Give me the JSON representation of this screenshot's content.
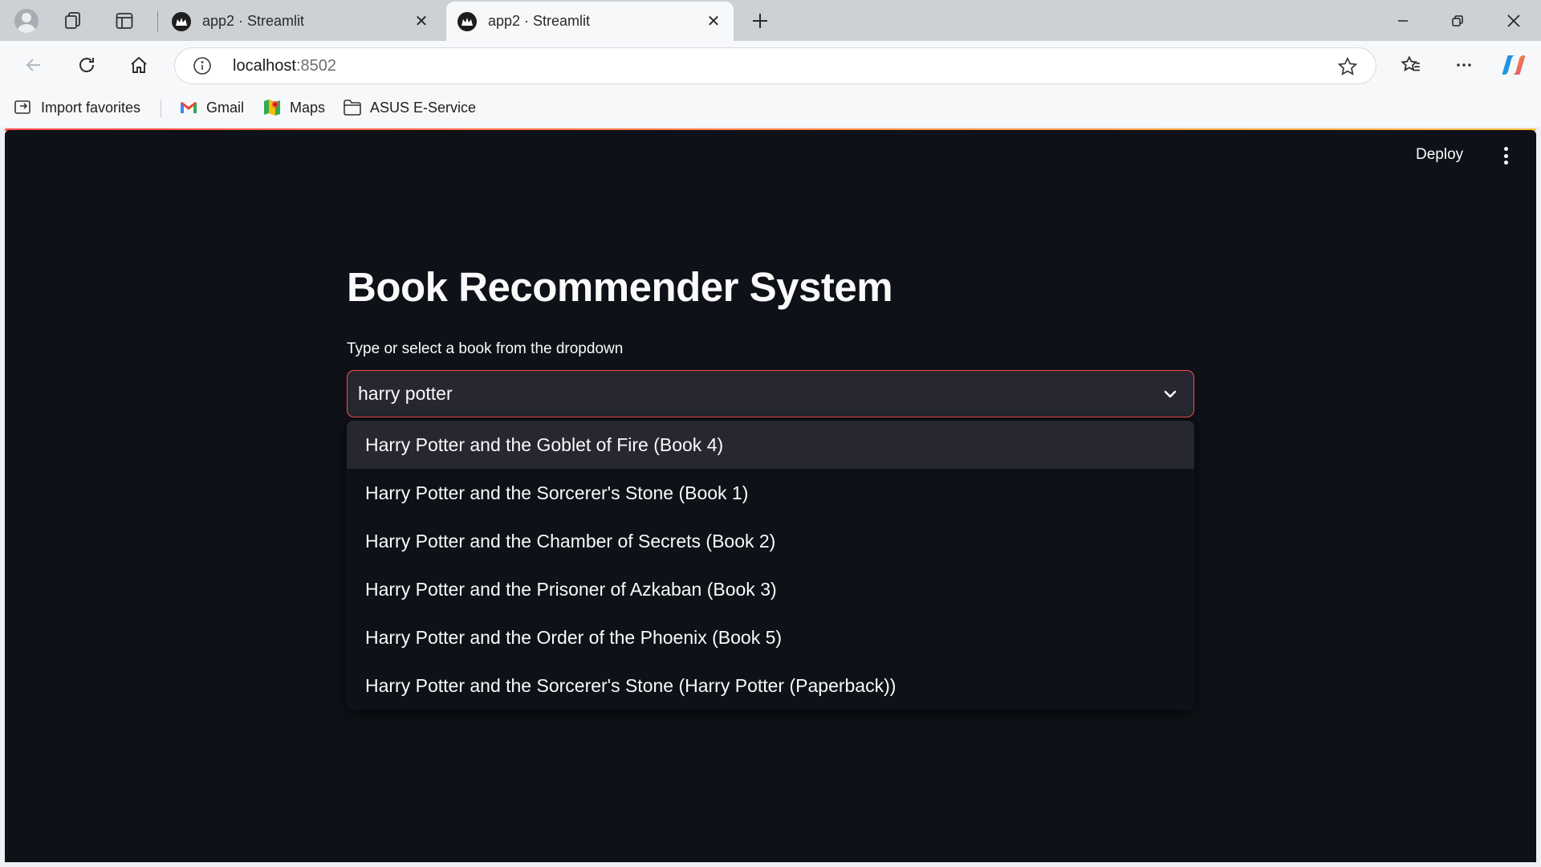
{
  "browser": {
    "tabs": [
      {
        "title": "app2 · Streamlit",
        "active": false
      },
      {
        "title": "app2 · Streamlit",
        "active": true
      }
    ],
    "url": {
      "host": "localhost",
      "port": ":8502"
    },
    "favorites": [
      {
        "label": "Import favorites",
        "icon": "import-favorites-icon"
      },
      {
        "label": "Gmail",
        "icon": "gmail-icon"
      },
      {
        "label": "Maps",
        "icon": "maps-icon"
      },
      {
        "label": "ASUS E-Service",
        "icon": "folder-icon"
      }
    ]
  },
  "app": {
    "toolbar": {
      "deploy_label": "Deploy"
    },
    "title": "Book Recommender System",
    "select": {
      "label": "Type or select a book from the dropdown",
      "value": "harry potter",
      "options": [
        "Harry Potter and the Goblet of Fire (Book 4)",
        "Harry Potter and the Sorcerer's Stone (Book 1)",
        "Harry Potter and the Chamber of Secrets (Book 2)",
        "Harry Potter and the Prisoner of Azkaban (Book 3)",
        "Harry Potter and the Order of the Phoenix (Book 5)",
        "Harry Potter and the Sorcerer's Stone (Harry Potter (Paperback))"
      ],
      "highlighted_index": 0
    }
  },
  "colors": {
    "accent": "#ff4b4b",
    "page_bg": "#0e1117",
    "widget_bg": "#262730",
    "text": "#fafafa"
  }
}
